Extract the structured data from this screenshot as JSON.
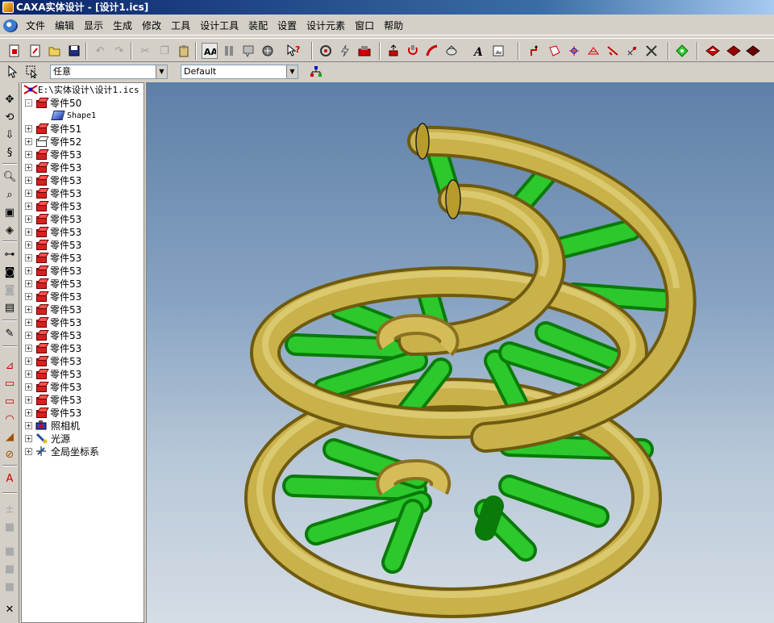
{
  "window": {
    "title": "CAXA实体设计 - [设计1.ics]"
  },
  "menu": [
    "文件",
    "编辑",
    "显示",
    "生成",
    "修改",
    "工具",
    "设计工具",
    "装配",
    "设置",
    "设计元素",
    "窗口",
    "帮助"
  ],
  "toolbar2": {
    "filter_value": "任意",
    "style_value": "Default"
  },
  "tree": {
    "root": "E:\\实体设计\\设计1.ics",
    "items": [
      {
        "label": "零件50",
        "expander": "-",
        "icon": "part-icon",
        "indent": 0
      },
      {
        "label": "Shape1",
        "expander": "",
        "icon": "shape-icon",
        "indent": 1
      },
      {
        "label": "零件51",
        "expander": "+",
        "icon": "part-icon",
        "indent": 0
      },
      {
        "label": "零件52",
        "expander": "+",
        "icon": "part-outline-icon",
        "indent": 0
      },
      {
        "label": "零件53",
        "expander": "+",
        "icon": "part-icon",
        "indent": 0
      },
      {
        "label": "零件53",
        "expander": "+",
        "icon": "part-icon",
        "indent": 0
      },
      {
        "label": "零件53",
        "expander": "+",
        "icon": "part-icon",
        "indent": 0
      },
      {
        "label": "零件53",
        "expander": "+",
        "icon": "part-icon",
        "indent": 0
      },
      {
        "label": "零件53",
        "expander": "+",
        "icon": "part-icon",
        "indent": 0
      },
      {
        "label": "零件53",
        "expander": "+",
        "icon": "part-icon",
        "indent": 0
      },
      {
        "label": "零件53",
        "expander": "+",
        "icon": "part-icon",
        "indent": 0
      },
      {
        "label": "零件53",
        "expander": "+",
        "icon": "part-icon",
        "indent": 0
      },
      {
        "label": "零件53",
        "expander": "+",
        "icon": "part-icon",
        "indent": 0
      },
      {
        "label": "零件53",
        "expander": "+",
        "icon": "part-icon",
        "indent": 0
      },
      {
        "label": "零件53",
        "expander": "+",
        "icon": "part-icon",
        "indent": 0
      },
      {
        "label": "零件53",
        "expander": "+",
        "icon": "part-icon",
        "indent": 0
      },
      {
        "label": "零件53",
        "expander": "+",
        "icon": "part-icon",
        "indent": 0
      },
      {
        "label": "零件53",
        "expander": "+",
        "icon": "part-icon",
        "indent": 0
      },
      {
        "label": "零件53",
        "expander": "+",
        "icon": "part-icon",
        "indent": 0
      },
      {
        "label": "零件53",
        "expander": "+",
        "icon": "part-icon",
        "indent": 0
      },
      {
        "label": "零件53",
        "expander": "+",
        "icon": "part-icon",
        "indent": 0
      },
      {
        "label": "零件53",
        "expander": "+",
        "icon": "part-icon",
        "indent": 0
      },
      {
        "label": "零件53",
        "expander": "+",
        "icon": "part-icon",
        "indent": 0
      },
      {
        "label": "零件53",
        "expander": "+",
        "icon": "part-icon",
        "indent": 0
      },
      {
        "label": "零件53",
        "expander": "+",
        "icon": "part-icon",
        "indent": 0
      },
      {
        "label": "照相机",
        "expander": "+",
        "icon": "camera-icon",
        "indent": 0
      },
      {
        "label": "光源",
        "expander": "+",
        "icon": "light-icon",
        "indent": 0
      },
      {
        "label": "全局坐标系",
        "expander": "+",
        "icon": "axes-icon",
        "indent": 0
      }
    ]
  },
  "colors": {
    "tube": "#c9b24a",
    "rod": "#1aa81a",
    "viewport_top": "#5e7fa8",
    "viewport_bottom": "#d5dde5"
  }
}
